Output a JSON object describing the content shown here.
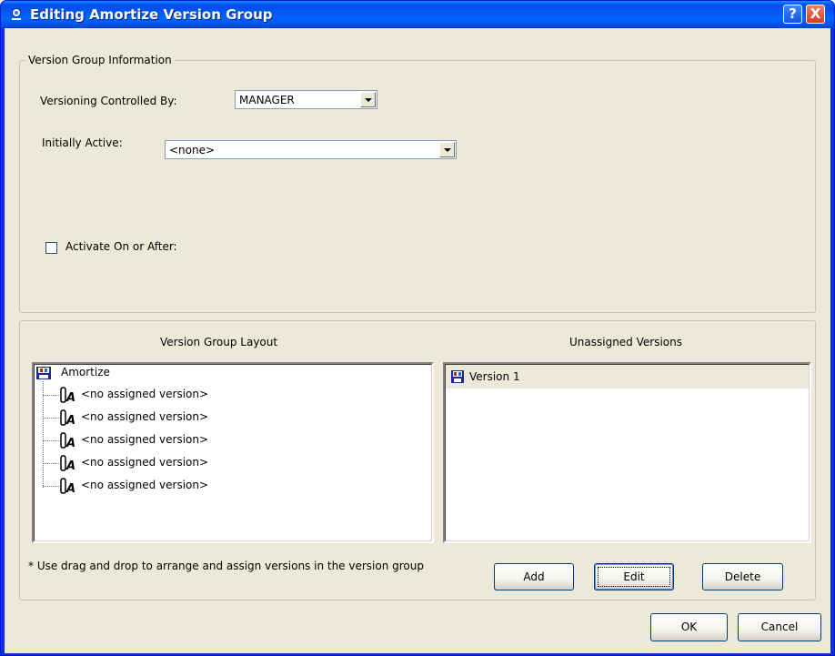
{
  "window": {
    "title": "Editing Amortize Version Group",
    "help_glyph": "?",
    "close_glyph": "X"
  },
  "info_group": {
    "title": "Version Group Information",
    "controlled_by_label": "Versioning Controlled By:",
    "controlled_by_value": "MANAGER",
    "initially_active_label": "Initially Active:",
    "initially_active_value": "<none>",
    "activate_label": "Activate On or After:",
    "activate_checked": false
  },
  "layout_group": {
    "layout_header": "Version Group Layout",
    "unassigned_header": "Unassigned Versions",
    "tree_root": "Amortize",
    "tree_children": [
      "<no assigned version>",
      "<no assigned version>",
      "<no assigned version>",
      "<no assigned version>",
      "<no assigned version>"
    ],
    "unassigned_items": [
      "Version 1"
    ],
    "hint": "* Use drag and drop to arrange and assign versions in the version group",
    "add_label": "Add",
    "edit_label": "Edit",
    "delete_label": "Delete"
  },
  "footer": {
    "ok_label": "OK",
    "cancel_label": "Cancel"
  },
  "icons": {
    "title_icon": "app-icon",
    "root_icon": "version-group-icon",
    "child_icon": "version-slot-icon",
    "version_icon": "version-icon",
    "combo_arrow": "chevron-down-icon"
  },
  "colors": {
    "titlebar": "#0054e3",
    "dialog_face": "#ece9d8",
    "close_button": "#d1401e"
  }
}
